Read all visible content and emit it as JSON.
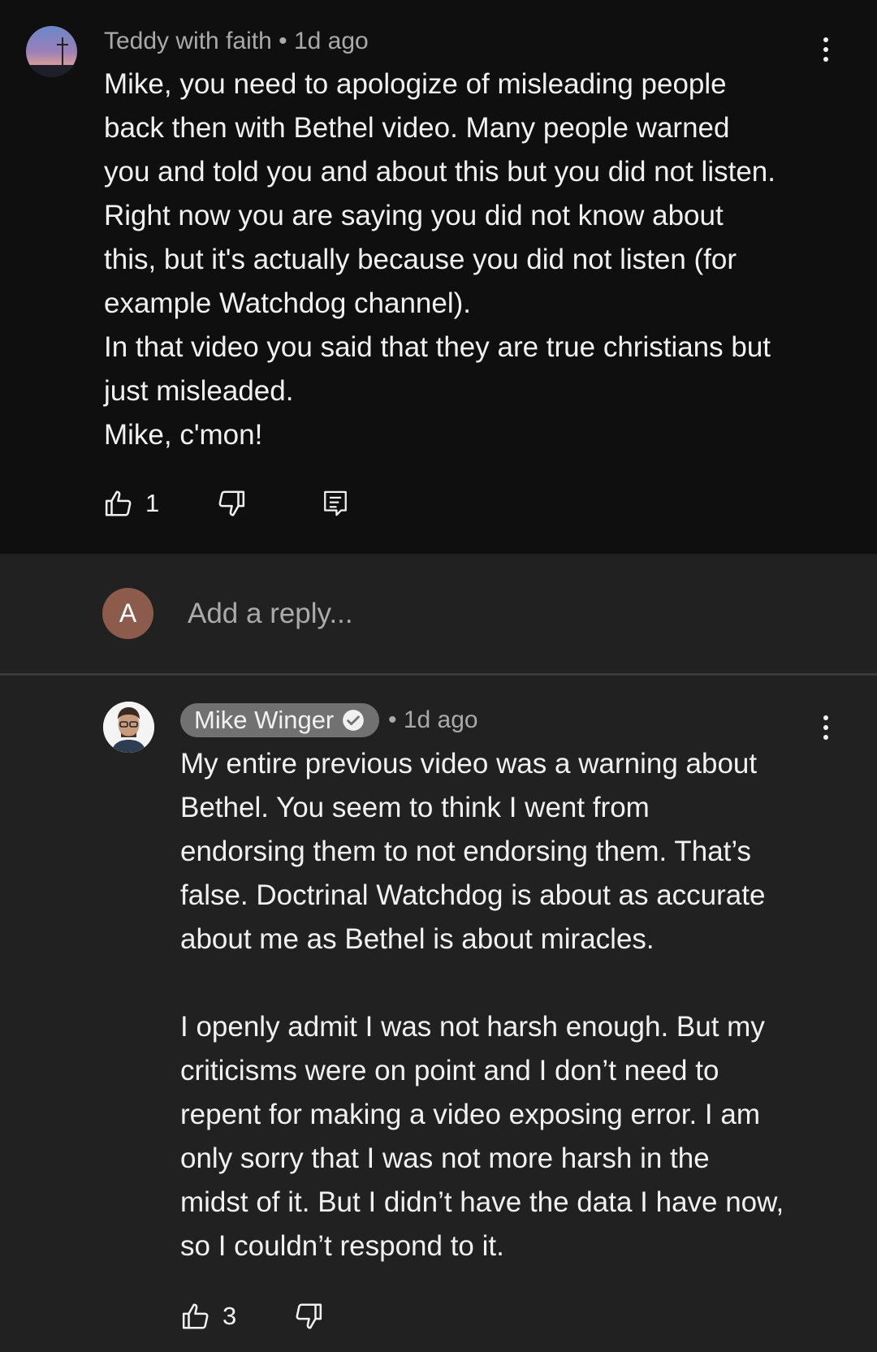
{
  "top_comment": {
    "author": "Teddy with faith",
    "time": "• 1d ago",
    "text": "Mike, you need to apologize of misleading people\nback then with Bethel video. Many people warned\nyou and told you and about this but you did not listen.\nRight now you are saying you did not know about\nthis, but it's actually because you did not listen (for\nexample Watchdog channel).\nIn that video you said that they are true christians but\njust misleaded.\nMike, c'mon!",
    "likes": "1",
    "icons": {
      "like": "thumbs-up-icon",
      "dislike": "thumbs-down-icon",
      "reply": "reply-icon",
      "menu": "more-vert-icon"
    }
  },
  "reply_box": {
    "avatar_letter": "A",
    "placeholder": "Add a reply..."
  },
  "reply_comment": {
    "author": "Mike Winger",
    "time": "• 1d ago",
    "text": "My entire previous video was a warning about\nBethel. You seem to think I went from\nendorsing them to not endorsing them. That’s\nfalse. Doctrinal Watchdog is about as accurate\nabout me as Bethel is about miracles.\n\nI openly admit I was not harsh enough. But my\ncriticisms were on point and I don’t need to\nrepent for making a video exposing error. I am\nonly sorry that I was not more harsh in the\nmidst of it. But I didn’t have the data I have now,\nso I couldn’t respond to it.",
    "likes": "3",
    "icons": {
      "verified": "verified-check-icon",
      "like": "thumbs-up-icon",
      "dislike": "thumbs-down-icon",
      "menu": "more-vert-icon"
    }
  },
  "colors": {
    "background_top": "#0f0f0f",
    "background_reply": "#212121",
    "text_primary": "#f1f1f1",
    "text_secondary": "#aaaaaa",
    "author_chip": "#717171",
    "reply_avatar": "#8d5b4c"
  }
}
